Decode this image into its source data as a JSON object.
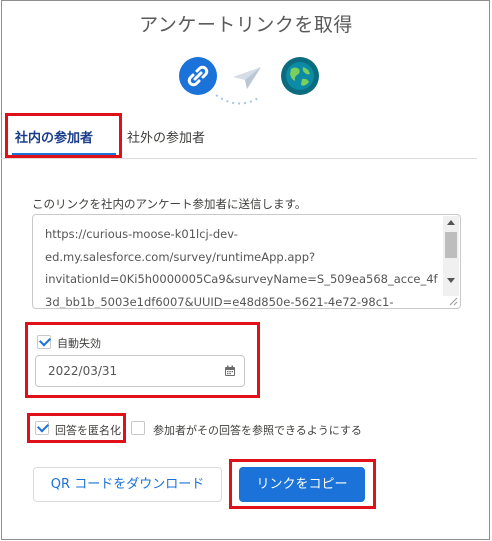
{
  "modal": {
    "title": "アンケートリンクを取得"
  },
  "icons": {
    "link": "link-icon",
    "plane": "paper-plane-icon",
    "globe": "globe-icon",
    "calendar": "calendar-icon"
  },
  "tabs": [
    {
      "label": "社内の参加者",
      "active": true
    },
    {
      "label": "社外の参加者",
      "active": false
    }
  ],
  "internal": {
    "description": "このリンクを社内のアンケート参加者に送信します。",
    "link_text": "https://curious-moose-k01lcj-dev-\ned.my.salesforce.com/survey/runtimeApp.app?\ninvitationId=0Ki5h0000005Ca9&surveyName=S_509ea568_acce_4f\n3d_bb1b_5003e1df6007&UUID=e48d850e-5621-4e72-98c1-",
    "auto_expire": {
      "label": "自動失効",
      "checked": true,
      "date": "2022/03/31"
    },
    "anonymize": {
      "label": "回答を匿名化",
      "checked": true
    },
    "share_with_participants": {
      "label": "参加者がその回答を参照できるようにする",
      "checked": false
    }
  },
  "buttons": {
    "download_qr": "QR コードをダウンロード",
    "copy_link": "リンクをコピー"
  },
  "colors": {
    "brand": "#1b72d8",
    "highlight": "#e0101a",
    "globe": "#0c6b7e"
  }
}
